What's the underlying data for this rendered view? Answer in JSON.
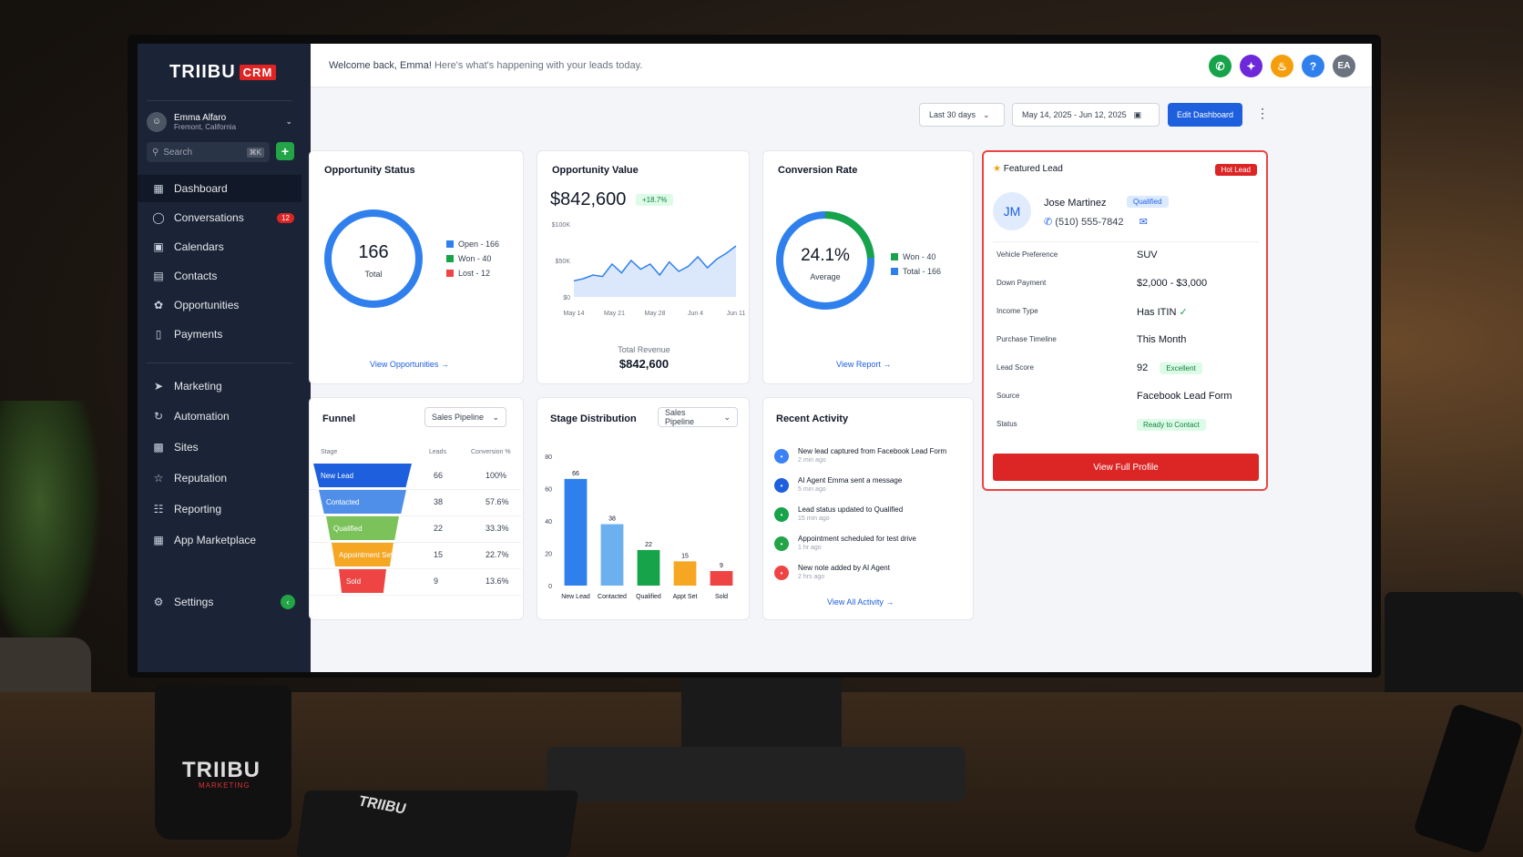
{
  "app": {
    "brand": "TRIIBU",
    "brand_tag": "CRM"
  },
  "user": {
    "name": "Emma Alfaro",
    "location": "Fremont, California",
    "initials": "EA"
  },
  "search": {
    "placeholder": "Search",
    "shortcut": "⌘K"
  },
  "sidebar": {
    "items": [
      {
        "label": "Dashboard",
        "icon": "grid-icon"
      },
      {
        "label": "Conversations",
        "icon": "chat-icon",
        "badge": "12"
      },
      {
        "label": "Calendars",
        "icon": "calendar-icon"
      },
      {
        "label": "Contacts",
        "icon": "contacts-icon"
      },
      {
        "label": "Opportunities",
        "icon": "opportunities-icon"
      },
      {
        "label": "Payments",
        "icon": "payments-icon"
      }
    ],
    "items2": [
      {
        "label": "Marketing",
        "icon": "send-icon"
      },
      {
        "label": "Automation",
        "icon": "automation-icon"
      },
      {
        "label": "Sites",
        "icon": "sites-icon"
      },
      {
        "label": "Reputation",
        "icon": "star-icon"
      },
      {
        "label": "Reporting",
        "icon": "reporting-icon"
      },
      {
        "label": "App Marketplace",
        "icon": "apps-icon"
      }
    ],
    "settings": "Settings"
  },
  "header": {
    "welcome": "Welcome back, Emma!",
    "subtitle": "Here's what's happening with your leads today."
  },
  "controls": {
    "range": "Last 30 days",
    "dates": "May 14, 2025 - Jun 12, 2025",
    "edit": "Edit Dashboard"
  },
  "opportunity_status": {
    "title": "Opportunity Status",
    "total": "166",
    "total_label": "Total",
    "legend": [
      "Open - 166",
      "Won - 40",
      "Lost - 12"
    ],
    "colors": [
      "#2f80ed",
      "#16a34a",
      "#ef4444"
    ],
    "link": "View Opportunities"
  },
  "opportunity_value": {
    "title": "Opportunity Value",
    "value": "$842,600",
    "change": "+18.7%",
    "revenue_label": "Total Revenue",
    "revenue": "$842,600"
  },
  "conversion": {
    "title": "Conversion Rate",
    "value": "24.1%",
    "label": "Average",
    "legend": [
      "Won - 40",
      "Total - 166"
    ],
    "link": "View Report",
    "fraction": 0.241
  },
  "funnel": {
    "title": "Funnel",
    "select": "Sales Pipeline",
    "headers": [
      "Stage",
      "Leads",
      "Conversion %"
    ],
    "rows": [
      {
        "stage": "New Lead",
        "leads": "66",
        "pct": "100%",
        "color": "#1d5fdd"
      },
      {
        "stage": "Contacted",
        "leads": "38",
        "pct": "57.6%",
        "color": "#4f8fea"
      },
      {
        "stage": "Qualified",
        "leads": "22",
        "pct": "33.3%",
        "color": "#7cc25a"
      },
      {
        "stage": "Appointment Set",
        "leads": "15",
        "pct": "22.7%",
        "color": "#f5a623"
      },
      {
        "stage": "Sold",
        "leads": "9",
        "pct": "13.6%",
        "color": "#ef4444"
      }
    ]
  },
  "stage": {
    "title": "Stage Distribution",
    "select": "Sales Pipeline"
  },
  "activity": {
    "title": "Recent Activity",
    "items": [
      {
        "text": "New lead captured from Facebook Lead Form",
        "time": "2 min ago",
        "color": "#3b82f6"
      },
      {
        "text": "AI Agent Emma sent a message",
        "time": "5 min ago",
        "color": "#1d5fdd"
      },
      {
        "text": "Lead status updated to Qualified",
        "time": "15 min ago",
        "color": "#16a34a"
      },
      {
        "text": "Appointment scheduled for test drive",
        "time": "1 hr ago",
        "color": "#22a447"
      },
      {
        "text": "New note added by AI Agent",
        "time": "2 hrs ago",
        "color": "#ef4444"
      }
    ],
    "link": "View All Activity"
  },
  "featured": {
    "title": "Featured Lead",
    "badge": "Hot Lead",
    "initials": "JM",
    "name": "Jose Martinez",
    "status_tag": "Qualified",
    "phone": "(510) 555-7842",
    "rows": [
      {
        "k": "Vehicle Preference",
        "v": "SUV"
      },
      {
        "k": "Down Payment",
        "v": "$2,000 - $3,000"
      },
      {
        "k": "Income Type",
        "v": "Has ITIN"
      },
      {
        "k": "Purchase Timeline",
        "v": "This Month"
      },
      {
        "k": "Lead Score",
        "v": "92"
      },
      {
        "k": "Source",
        "v": "Facebook Lead Form"
      },
      {
        "k": "Status",
        "v": ""
      }
    ],
    "score_tag": "Excellent",
    "status_value": "Ready to Contact",
    "button": "View Full Profile"
  },
  "desk": {
    "mug_brand": "TRIIBU",
    "mug_sub": "MARKETING",
    "notebook_brand": "TRIIBU"
  },
  "chart_data": [
    {
      "type": "line",
      "title": "Opportunity Value",
      "x": [
        "May 14",
        "May 16",
        "May 18",
        "May 20",
        "May 21",
        "May 23",
        "May 25",
        "May 27",
        "May 28",
        "May 30",
        "Jun 1",
        "Jun 3",
        "Jun 4",
        "Jun 6",
        "Jun 8",
        "Jun 10",
        "Jun 11",
        "Jun 12"
      ],
      "x_ticks": [
        "May 14",
        "May 21",
        "May 28",
        "Jun 4",
        "Jun 11"
      ],
      "values": [
        22,
        25,
        30,
        28,
        45,
        33,
        50,
        38,
        45,
        30,
        48,
        35,
        42,
        55,
        40,
        52,
        60,
        70
      ],
      "y_ticks": [
        "$100K",
        "$50K",
        "$0"
      ],
      "ylim": [
        0,
        100
      ]
    },
    {
      "type": "bar",
      "title": "Stage Distribution",
      "categories": [
        "New Lead",
        "Contacted",
        "Qualified",
        "Appt Set",
        "Sold"
      ],
      "values": [
        66,
        38,
        22,
        15,
        9
      ],
      "colors": [
        "#2f80ed",
        "#6cb0f0",
        "#16a34a",
        "#f5a623",
        "#ef4444"
      ],
      "y_ticks": [
        "80",
        "60",
        "40",
        "20",
        "0"
      ],
      "ylim": [
        0,
        80
      ]
    }
  ]
}
